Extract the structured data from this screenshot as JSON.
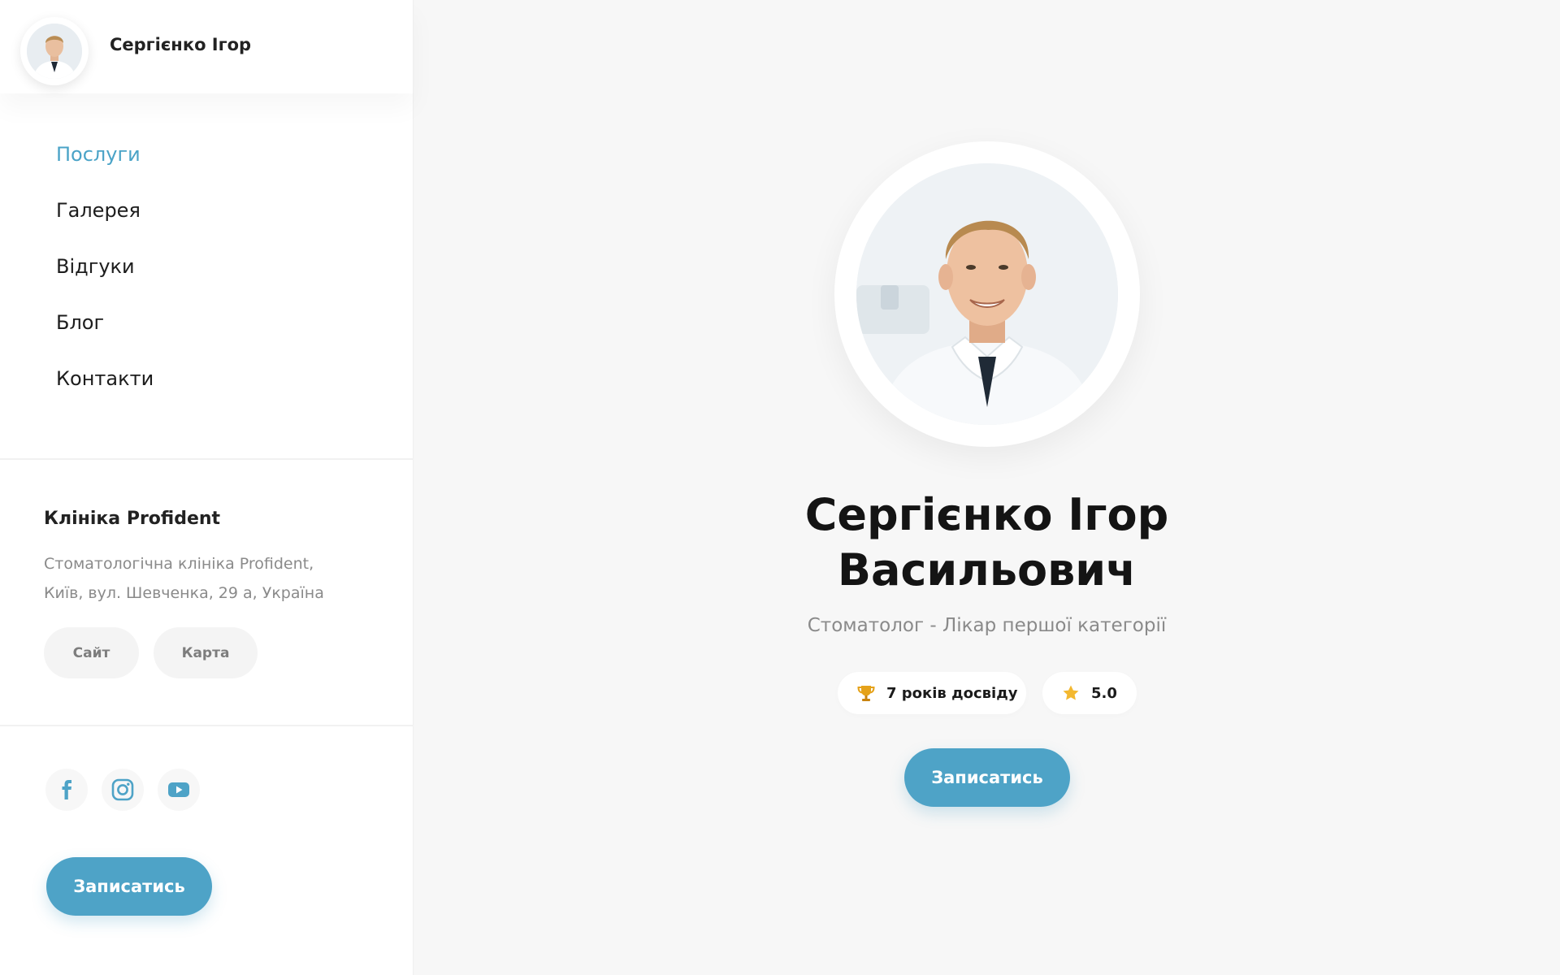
{
  "profile": {
    "short_name": "Сергієнко Ігор",
    "full_name_line1": "Сергієнко Ігор",
    "full_name_line2": "Васильович",
    "subtitle": "Стоматолог - Лікар першої категорії"
  },
  "nav": {
    "items": [
      {
        "label": "Послуги",
        "active": true
      },
      {
        "label": "Галерея",
        "active": false
      },
      {
        "label": "Відгуки",
        "active": false
      },
      {
        "label": "Блог",
        "active": false
      },
      {
        "label": "Контакти",
        "active": false
      }
    ]
  },
  "clinic": {
    "title": "Клініка Profident",
    "address_line1": "Стоматологічна клініка Profident,",
    "address_line2": "Київ, вул. Шевченка, 29 а, Україна",
    "site_label": "Сайт",
    "map_label": "Карта"
  },
  "social": [
    "facebook-icon",
    "instagram-icon",
    "youtube-icon"
  ],
  "badges": {
    "experience": "7 років досвіду",
    "rating": "5.0"
  },
  "cta_label": "Записатись",
  "colors": {
    "accent": "#4ea3c7",
    "text": "#1b1b1b",
    "muted": "#8a8a8a",
    "background": "#f7f7f7",
    "trophy": "#e5a21a",
    "star": "#f3b830"
  }
}
